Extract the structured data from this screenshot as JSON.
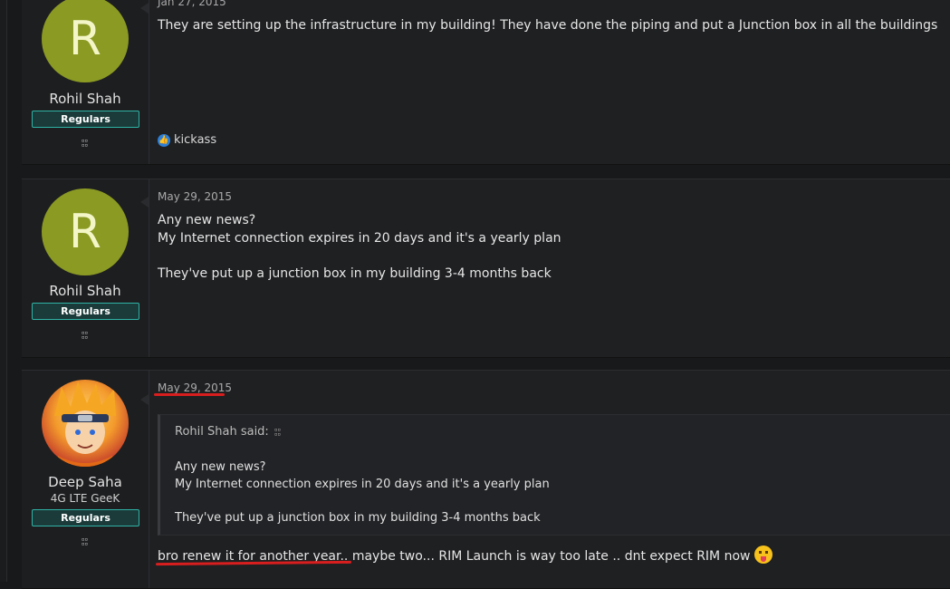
{
  "posts": [
    {
      "username": "Rohil Shah",
      "avatar_letter": "R",
      "badge": "Regulars",
      "date": "Jan 27, 2015",
      "lines": [
        "They are setting up the infrastructure in my building! They have done the piping and put a Junction box in all the buildings"
      ],
      "reaction": "kickass"
    },
    {
      "username": "Rohil Shah",
      "avatar_letter": "R",
      "badge": "Regulars",
      "date": "May 29, 2015",
      "lines": [
        "Any new news?",
        "My Internet connection expires in 20 days and it's a yearly plan",
        "",
        "They've put up a junction box in my building 3-4 months back"
      ]
    },
    {
      "username": "Deep Saha",
      "user_title": "4G LTE GeeK",
      "badge": "Regulars",
      "date": "May 29, 2015",
      "quote": {
        "author": "Rohil Shah said:",
        "lines": [
          "Any new news?",
          "My Internet connection expires in 20 days and it's a yearly plan",
          "",
          "They've put up a junction box in my building 3-4 months back"
        ]
      },
      "reply": "bro renew it for another year.. maybe two... RIM Launch is way too late .. dnt expect RIM now"
    }
  ],
  "icons": {
    "tiny": "flag-icon",
    "like": "like-icon",
    "emoji": "tongue-out-emoji"
  },
  "colors": {
    "background": "#18191b",
    "avatar": "#8b9a23",
    "badge_border": "#2fb3a5",
    "annotation": "#d81e1e"
  }
}
